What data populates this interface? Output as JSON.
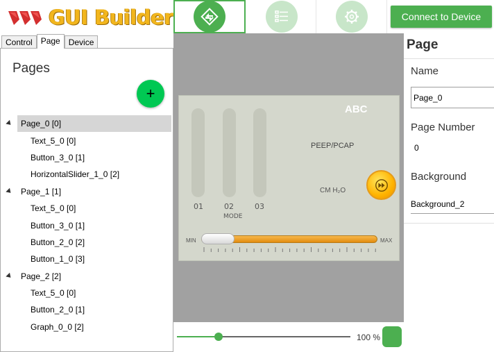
{
  "app": {
    "title": "GUI Builder",
    "connect_label": "Connect to Device",
    "accent": "#4caf50"
  },
  "header": {
    "nav": [
      {
        "icon": "swap-pages-icon",
        "active": true
      },
      {
        "icon": "list-icon",
        "active": false
      },
      {
        "icon": "gear-icon",
        "active": false
      }
    ]
  },
  "left": {
    "tabs": [
      "Control",
      "Page",
      "Device"
    ],
    "selected_tab": "Page",
    "title": "Pages",
    "add_label": "+",
    "tree": [
      {
        "label": "Page_0 [0]",
        "selected": true,
        "children": [
          "Text_5_0 [0]",
          "Button_3_0 [1]",
          "HorizontalSlider_1_0 [2]"
        ]
      },
      {
        "label": "Page_1 [1]",
        "selected": false,
        "children": [
          "Text_5_0 [0]",
          "Button_3_0 [1]",
          "Button_2_0 [2]",
          "Button_1_0 [3]"
        ]
      },
      {
        "label": "Page_2 [2]",
        "selected": false,
        "children": [
          "Text_5_0 [0]",
          "Button_2_0 [1]",
          "Graph_0_0 [2]"
        ]
      }
    ]
  },
  "preview": {
    "abc": "ABC",
    "mode_title": "PEEP/PCAP",
    "unit": "CM H₂O",
    "bars": [
      "01",
      "02",
      "03"
    ],
    "mode_label": "MODE",
    "slider_min": "MIN",
    "slider_max": "MAX",
    "slider_value": 0.0
  },
  "zoom": {
    "label": "100 %",
    "value": 0.24
  },
  "right": {
    "title": "Page",
    "name_label": "Name",
    "name_value": "Page_0",
    "number_label": "Page Number",
    "number_value": "0",
    "background_label": "Background",
    "background_value": "Background_2"
  }
}
